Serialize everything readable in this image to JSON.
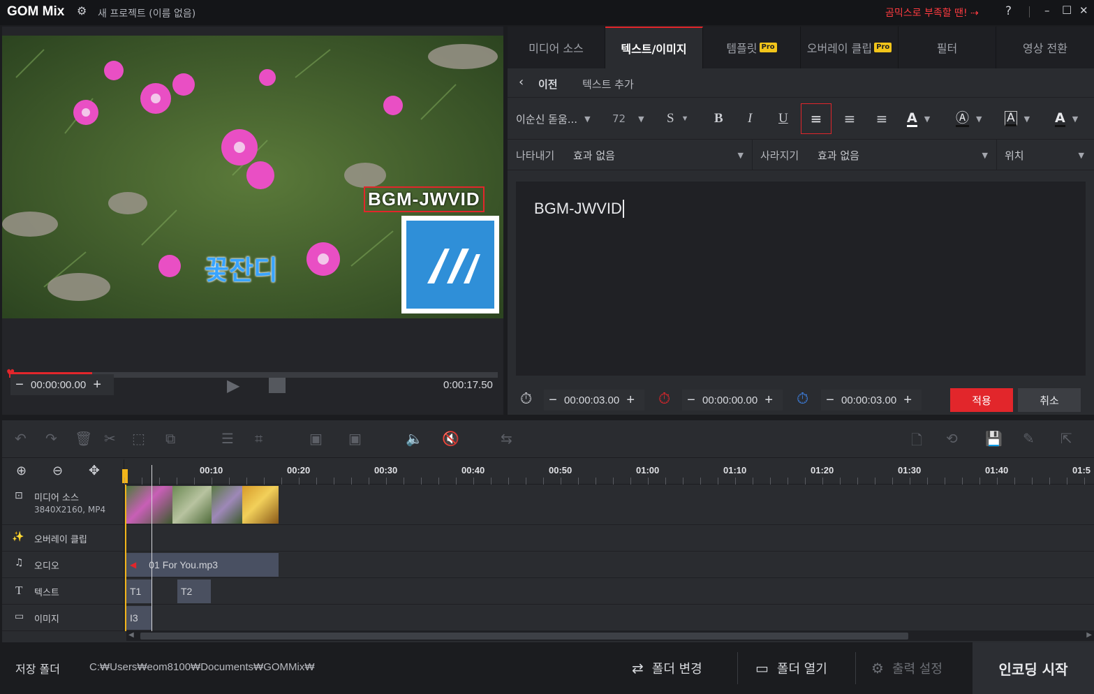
{
  "titlebar": {
    "logo": "GOM Mix",
    "project_title": "새 프로젝트 (이름 없음)",
    "promo": "곰믹스로 부족할 땐! ⇢",
    "help": "?",
    "minimize": "–",
    "maximize": "□",
    "close": "✕"
  },
  "preview": {
    "overlay_text_1": "BGM-JWVID",
    "overlay_text_2": "꽃잔디",
    "current_time": "00:00:00.00",
    "total_time": "0:00:17.50",
    "progress_fraction": 0.17
  },
  "tabs": [
    {
      "label": "미디어 소스",
      "pro": ""
    },
    {
      "label": "텍스트/이미지",
      "pro": ""
    },
    {
      "label": "템플릿",
      "pro": "Pro"
    },
    {
      "label": "오버레이 클립",
      "pro": "Pro"
    },
    {
      "label": "필터",
      "pro": ""
    },
    {
      "label": "영상 전환",
      "pro": ""
    }
  ],
  "text_panel": {
    "back_label": "이전",
    "breadcrumb": "텍스트 추가",
    "font_name": "이순신 돋움...",
    "font_size": "72",
    "strike": "S",
    "bold": "B",
    "italic": "I",
    "underline": "U",
    "appear_label": "나타내기",
    "appear_value": "효과 없음",
    "disappear_label": "사라지기",
    "disappear_value": "효과 없음",
    "position_label": "위치",
    "text_content": "BGM-JWVID",
    "duration_time": "00:00:03.00",
    "start_time": "00:00:00.00",
    "end_time": "00:00:03.00",
    "apply": "적용",
    "cancel": "취소"
  },
  "timeline": {
    "ruler": [
      "00:10",
      "00:20",
      "00:30",
      "00:40",
      "00:50",
      "01:00",
      "01:10",
      "01:20",
      "01:30",
      "01:40",
      "01:5"
    ],
    "tracks": {
      "media": {
        "label": "미디어 소스",
        "sub": "3840X2160, MP4"
      },
      "overlay": {
        "label": "오버레이 클립"
      },
      "audio": {
        "label": "오디오",
        "clip": "01 For You.mp3"
      },
      "text": {
        "label": "텍스트",
        "clips": [
          "T1",
          "T2"
        ]
      },
      "image": {
        "label": "이미지",
        "clip": "I3"
      }
    }
  },
  "footer": {
    "save_folder_label": "저장 폴더",
    "path": "C:₩Users₩eom8100₩Documents₩GOMMix₩",
    "change_folder": "폴더 변경",
    "open_folder": "폴더 열기",
    "output_settings": "출력 설정",
    "encode": "인코딩 시작"
  },
  "colors": {
    "accent": "#e2262b",
    "pro_badge": "#f2c51a",
    "logo_blue": "#2f8fd8"
  }
}
